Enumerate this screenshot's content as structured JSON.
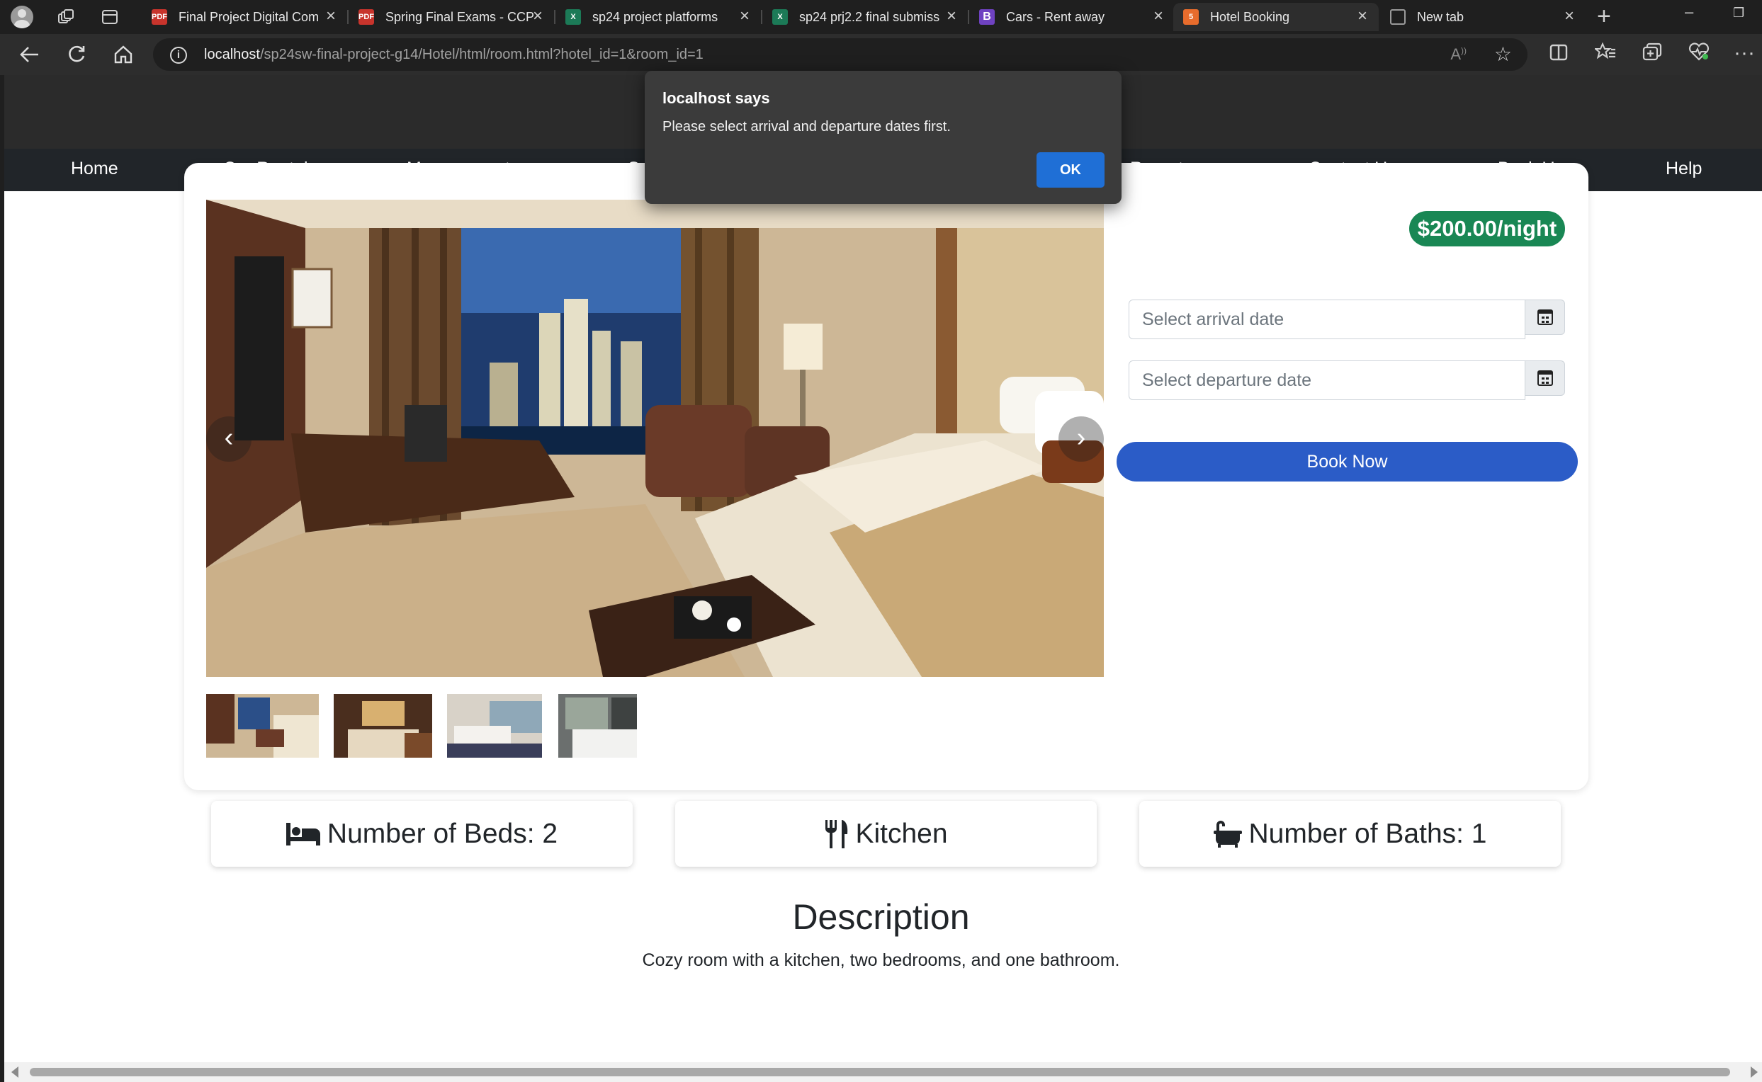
{
  "browser": {
    "tabs": [
      {
        "title": "Final Project Digital Com",
        "favicon": "PDF",
        "color": "#c8342c"
      },
      {
        "title": "Spring Final Exams - CCP",
        "favicon": "PDF",
        "color": "#c8342c"
      },
      {
        "title": "sp24 project platforms",
        "favicon": "xlsx",
        "color": "#1c7a57"
      },
      {
        "title": "sp24 prj2.2 final submiss",
        "favicon": "xlsx",
        "color": "#1c7a57"
      },
      {
        "title": "Cars - Rent away",
        "favicon": "B",
        "color": "#6f42c1"
      },
      {
        "title": "Hotel Booking",
        "favicon": "html",
        "color": "#e86c2c"
      },
      {
        "title": "New tab",
        "favicon": "newtab",
        "color": "#2d2d2d"
      }
    ],
    "url_host": "localhost",
    "url_path": "/sp24sw-final-project-g14/Hotel/html/room.html?hotel_id=1&room_id=1"
  },
  "nav": {
    "items": [
      "Home",
      "Car Rental",
      "Management",
      "Sa",
      "Reports",
      "Contact Us",
      "Back Up",
      "Help"
    ]
  },
  "room": {
    "price": "$200.00/night",
    "arrival_placeholder": "Select arrival date",
    "departure_placeholder": "Select departure date",
    "book_label": "Book Now",
    "features": {
      "beds": "Number of Beds: 2",
      "kitchen": "Kitchen",
      "baths": "Number of Baths: 1"
    },
    "description_title": "Description",
    "description_text": "Cozy room with a kitchen, two bedrooms, and one bathroom."
  },
  "dialog": {
    "title": "localhost says",
    "message": "Please select arrival and departure dates first.",
    "ok_label": "OK"
  },
  "colors": {
    "navbar": "#212529",
    "price_badge": "#198754",
    "book_button": "#2b5cc7",
    "dialog_ok": "#1f6fd6"
  }
}
